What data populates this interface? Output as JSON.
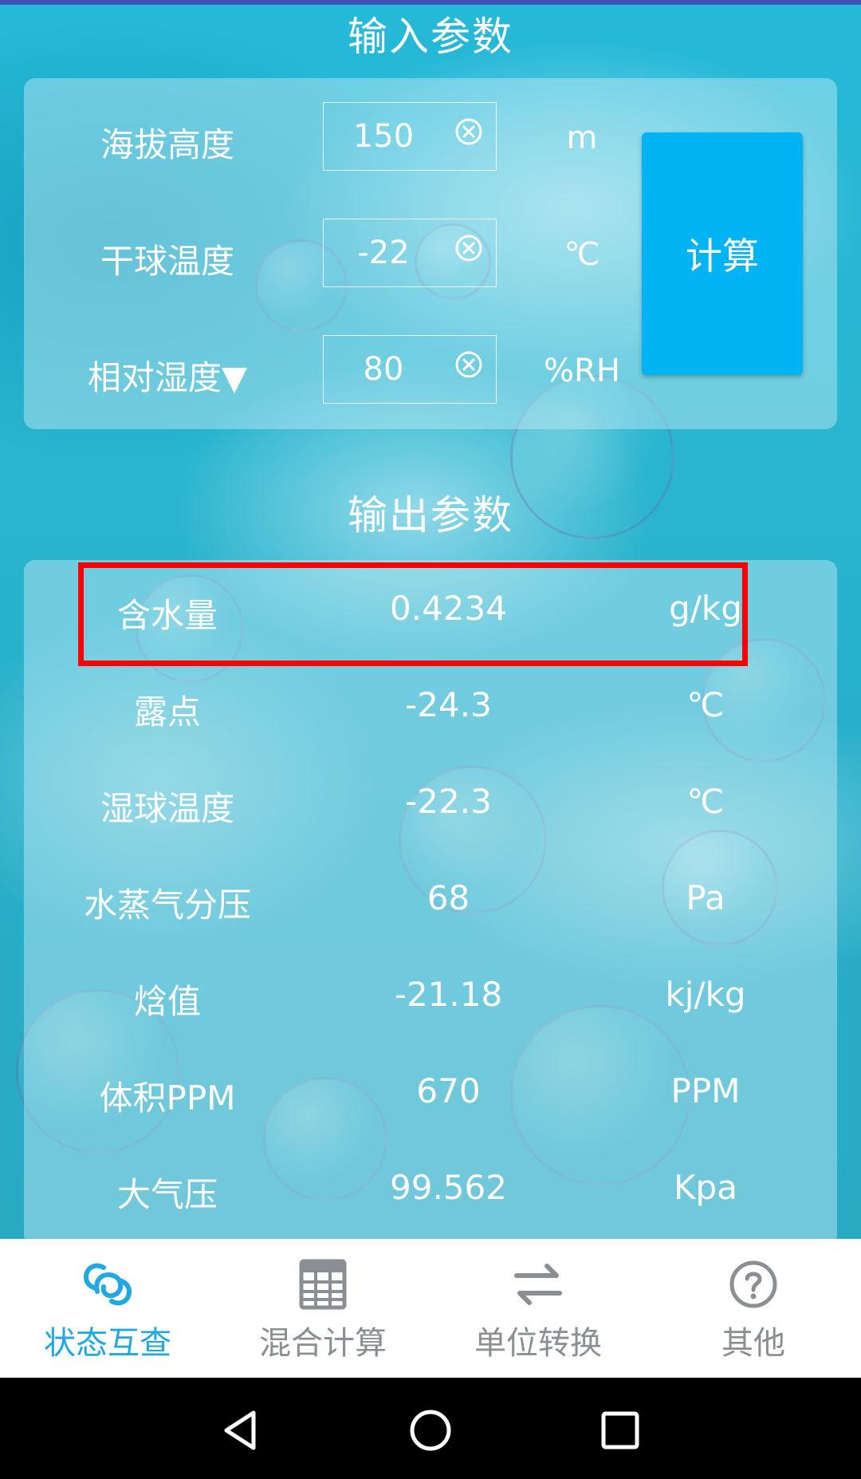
{
  "input_section": {
    "title": "输入参数",
    "fields": [
      {
        "label": "海拔高度",
        "value": "150",
        "unit": "m"
      },
      {
        "label": "干球温度",
        "value": "-22",
        "unit": "℃"
      },
      {
        "label": "相对湿度▼",
        "value": "80",
        "unit": "%RH"
      }
    ],
    "calculate_label": "计算"
  },
  "output_section": {
    "title": "输出参数",
    "rows": [
      {
        "label": "含水量",
        "value": "0.4234",
        "unit": "g/kg"
      },
      {
        "label": "露点",
        "value": "-24.3",
        "unit": "℃"
      },
      {
        "label": "湿球温度",
        "value": "-22.3",
        "unit": "℃"
      },
      {
        "label": "水蒸气分压",
        "value": "68",
        "unit": "Pa"
      },
      {
        "label": "焓值",
        "value": "-21.18",
        "unit": "kj/kg"
      },
      {
        "label": "体积PPM",
        "value": "670",
        "unit": "PPM"
      },
      {
        "label": "大气压",
        "value": "99.562",
        "unit": "Kpa"
      }
    ]
  },
  "bottom_nav": {
    "items": [
      {
        "label": "状态互查",
        "icon": "link-icon",
        "active": true
      },
      {
        "label": "混合计算",
        "icon": "calculator-icon",
        "active": false
      },
      {
        "label": "单位转换",
        "icon": "swap-icon",
        "active": false
      },
      {
        "label": "其他",
        "icon": "help-icon",
        "active": false
      }
    ]
  },
  "colors": {
    "accent": "#00b4f4",
    "nav_active": "#20a8e0",
    "nav_inactive": "#8b8f93",
    "highlight": "#ff0000"
  }
}
